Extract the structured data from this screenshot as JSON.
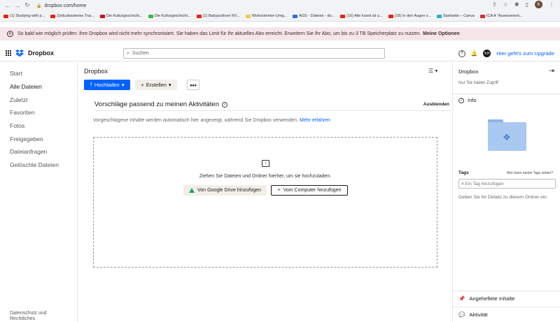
{
  "browser": {
    "url": "dropbox.com/home",
    "bookmarks": [
      {
        "label": "(1) Studying with p...",
        "color": "#e62117"
      },
      {
        "label": "Zyklusbasiertes Trai...",
        "color": "#e62117"
      },
      {
        "label": "Die Kulturgeschicht...",
        "color": "#c4161c"
      },
      {
        "label": "Die Kulturgeschicht...",
        "color": "#3bb54a"
      },
      {
        "label": "(1) Babypullover RV...",
        "color": "#e62117"
      },
      {
        "label": "Wohnzimmer-Umg...",
        "color": "#f2c94c"
      },
      {
        "label": "AGS - Dateien - do...",
        "color": "#2f6fd8"
      },
      {
        "label": "(16) Alle krank ist u...",
        "color": "#e62117"
      },
      {
        "label": "(18) In den Augen v...",
        "color": "#e62117"
      },
      {
        "label": "Startseite – Canva",
        "color": "#2ab0c8"
      },
      {
        "label": "ICA A \"Assessment...",
        "color": "#d6302f"
      }
    ],
    "profile_initial": "K"
  },
  "banner": {
    "text": "So bald wie möglich prüfen: Ihre Dropbox wird nicht mehr synchronisiert. Sie haben das Limit für Ihr aktuelles Abo erreicht. Erweitern Sie Ihr Abo, um bis zu 3 TB Speicherplatz zu nutzen.",
    "link": "Meine Optionen"
  },
  "header": {
    "logo": "Dropbox",
    "search_placeholder": "Suchen",
    "user_initials": "KH",
    "upgrade": "Hier geht's zum Upgrade"
  },
  "sidebar": {
    "items": [
      "Start",
      "Alle Dateien",
      "Zuletzt",
      "Favoriten",
      "Fotos",
      "Freigegeben",
      "Dateianfragen",
      "Gelöschte Dateien"
    ],
    "footer": "Datenschutz und Rechtliches"
  },
  "main": {
    "title": "Dropbox",
    "upload": "Hochladen",
    "create": "Erstellen",
    "more": "•••",
    "suggestions_title": "Vorschläge passend zu meinen Aktivitäten",
    "hide": "Ausblenden",
    "suggestions_desc": "Vorgeschlagene Inhalte werden automatisch hier angezeigt, während Sie Dropbox verwenden.",
    "learn_more": "Mehr erfahren",
    "drop_text": "Ziehen Sie Dateien und Ordner hierher, um sie hochzuladen.",
    "google_drive": "Von Google Drive hinzufügen",
    "computer": "Vom Computer hinzufügen"
  },
  "details": {
    "title": "Dropbox",
    "access": "Nur Sie haben Zugriff",
    "info": "Info",
    "tags": "Tags",
    "tags_who": "Wer kann meine Tags sehen?",
    "tag_placeholder": "# Ein Tag hinzufügen",
    "details_prompt": "Geben Sie Ihr Details zu diesem Ordner ein.",
    "pinned": "Angeheftete Inhalte",
    "activity": "Aktivität"
  },
  "colors": {
    "accent": "#0061fe",
    "banner_bg": "#f5e6ea"
  }
}
